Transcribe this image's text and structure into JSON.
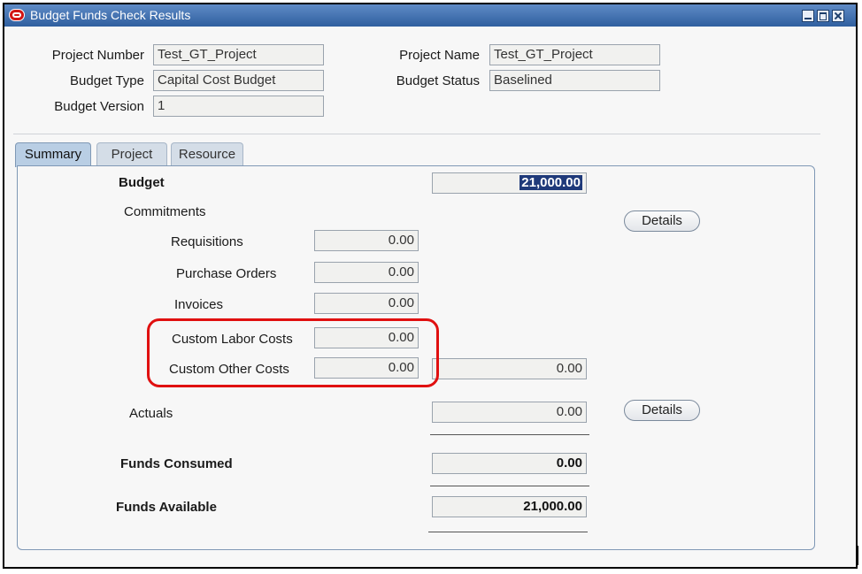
{
  "window": {
    "title": "Budget Funds Check Results",
    "controls": {
      "minimize_icon": "minimize-icon",
      "maximize_icon": "maximize-icon",
      "close_icon": "close-icon"
    }
  },
  "header": {
    "project_number_label": "Project Number",
    "project_number_value": "Test_GT_Project",
    "project_name_label": "Project Name",
    "project_name_value": "Test_GT_Project",
    "budget_type_label": "Budget Type",
    "budget_type_value": "Capital Cost Budget",
    "budget_status_label": "Budget Status",
    "budget_status_value": "Baselined",
    "budget_version_label": "Budget Version",
    "budget_version_value": "1"
  },
  "tabs": [
    {
      "label": "Summary",
      "active": true
    },
    {
      "label": "Project",
      "active": false
    },
    {
      "label": "Resource",
      "active": false
    }
  ],
  "summary": {
    "budget_label": "Budget",
    "budget_value": "21,000.00",
    "commitments_label": "Commitments",
    "commitments_details_button": "Details",
    "requisitions_label": "Requisitions",
    "requisitions_value": "0.00",
    "purchase_orders_label": "Purchase Orders",
    "purchase_orders_value": "0.00",
    "invoices_label": "Invoices",
    "invoices_value": "0.00",
    "custom_labor_costs_label": "Custom Labor Costs",
    "custom_labor_costs_value": "0.00",
    "custom_other_costs_label": "Custom Other Costs",
    "custom_other_costs_value": "0.00",
    "commitments_total_value": "0.00",
    "actuals_label": "Actuals",
    "actuals_value": "0.00",
    "actuals_details_button": "Details",
    "funds_consumed_label": "Funds Consumed",
    "funds_consumed_value": "0.00",
    "funds_available_label": "Funds Available",
    "funds_available_value": "21,000.00"
  },
  "colors": {
    "titlebar": "#2f5f9f",
    "highlight": "#e01010",
    "selection": "#1f3a7a",
    "tab_active": "#b9cee4"
  }
}
